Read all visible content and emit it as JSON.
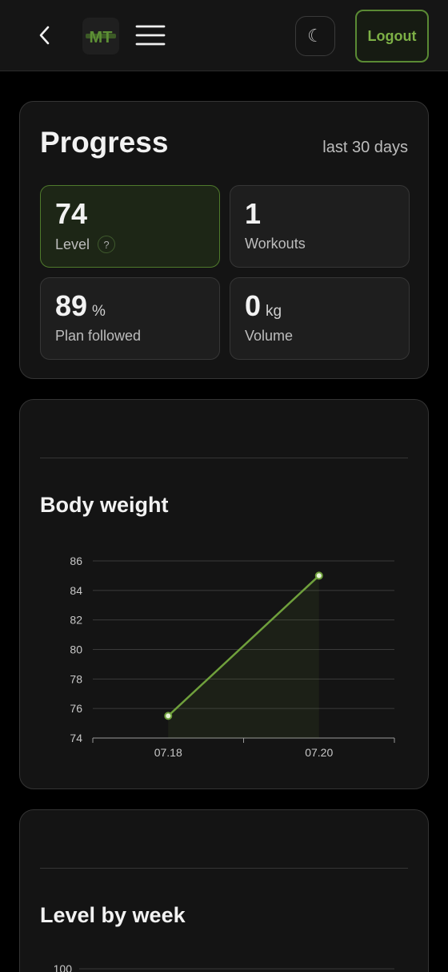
{
  "header": {
    "back_icon": "chevron-left-icon",
    "logo_text": "MT",
    "menu_icon": "hamburger-icon",
    "theme_icon": "☾",
    "logout_label": "Logout",
    "accent_color": "#6fa03c"
  },
  "progress": {
    "title": "Progress",
    "period": "last 30 days",
    "stats": [
      {
        "value": "74",
        "unit": "",
        "label": "Level",
        "help": "?"
      },
      {
        "value": "1",
        "unit": "",
        "label": "Workouts"
      },
      {
        "value": "89",
        "unit": "%",
        "label": "Plan followed"
      },
      {
        "value": "0",
        "unit": "kg",
        "label": "Volume"
      }
    ]
  },
  "chart_data": [
    {
      "type": "area",
      "title": "Body weight",
      "categories": [
        "07.18",
        "07.20"
      ],
      "values": [
        75.5,
        85
      ],
      "ylim": [
        74,
        86
      ],
      "yticks": [
        74,
        76,
        78,
        80,
        82,
        84,
        86
      ],
      "grid": true,
      "color": "#6fa03c"
    },
    {
      "type": "line",
      "title": "Level by week",
      "yticks": [
        100
      ]
    }
  ]
}
